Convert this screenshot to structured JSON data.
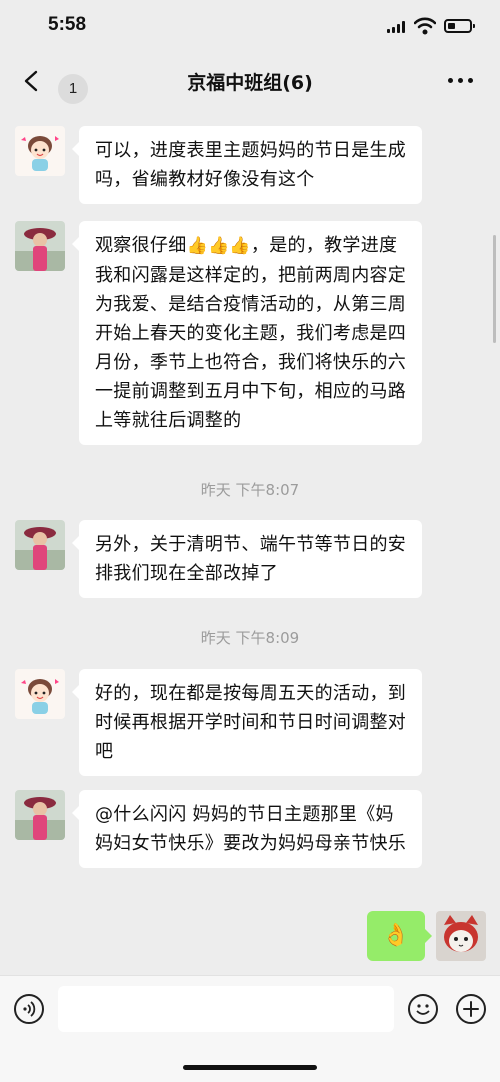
{
  "status_bar": {
    "time": "5:58"
  },
  "nav": {
    "back_badge": "1",
    "title": "京福中班组(6)"
  },
  "messages": [
    {
      "text": "可以，进度表里主题妈妈的节日是生成吗，省编教材好像没有这个"
    },
    {
      "text_part1": "观察很仔细",
      "emoji": "👍👍👍",
      "text_part2": "，是的，教学进度我和闪露是这样定的，把前两周内容定为我爱、是结合疫情活动的，从第三周开始上春天的变化主题，我们考虑是四月份，季节上也符合，我们将快乐的六一提前调整到五月中下旬，相应的马路上等就往后调整的"
    },
    {
      "text": "另外，关于清明节、端午节等节日的安排我们现在全部改掉了"
    },
    {
      "text": "好的，现在都是按每周五天的活动，到时候再根据开学时间和节日时间调整对吧"
    },
    {
      "text": "@什么闪闪 妈妈的节日主题那里《妈妈妇女节快乐》要改为妈妈母亲节快乐"
    }
  ],
  "timestamps": [
    "昨天 下午8:07",
    "昨天 下午8:09"
  ],
  "my_message": {
    "emoji": "👌"
  },
  "icons": [
    "signal-icon",
    "wifi-icon",
    "battery-icon",
    "back-chevron-icon",
    "more-icon",
    "voice-icon",
    "emoji-icon",
    "plus-icon"
  ],
  "colors": {
    "background": "#ededed",
    "my_bubble": "#95ec69",
    "bubble": "#ffffff",
    "timestamp": "#9c9c9c"
  }
}
